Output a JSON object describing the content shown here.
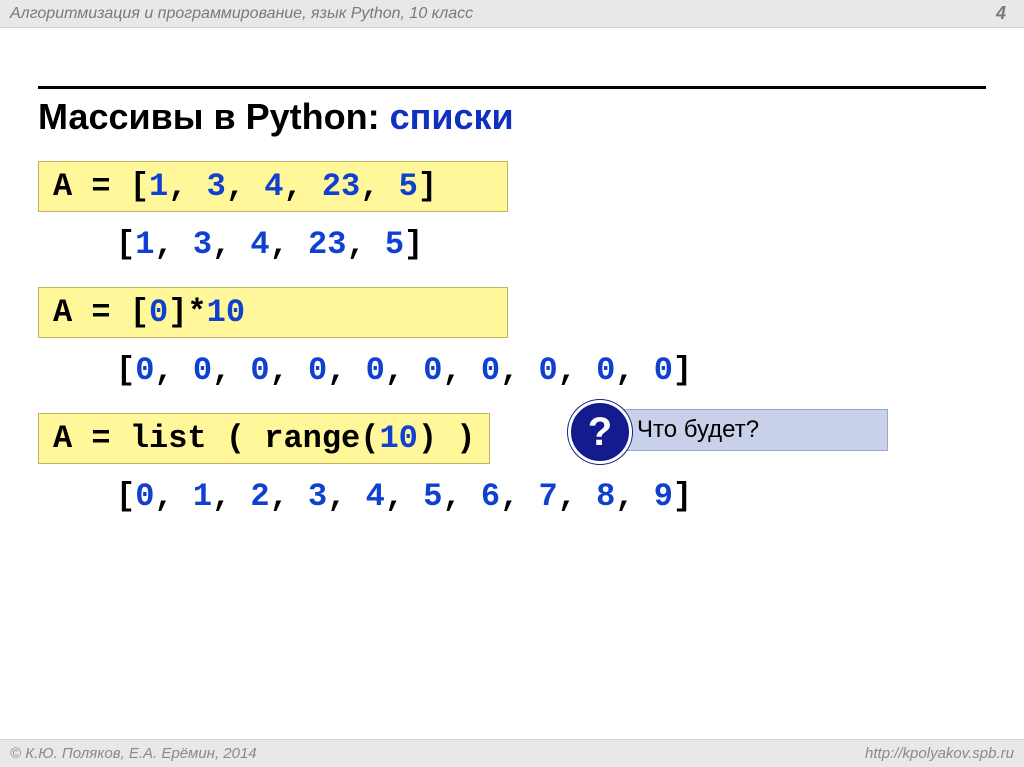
{
  "header": {
    "title": "Алгоритмизация и программирование, язык Python, 10 класс",
    "page": "4"
  },
  "heading": {
    "main": "Массивы в Python: ",
    "accent": "списки"
  },
  "code1": {
    "lhs": "A = [",
    "n1": "1",
    "c1": ", ",
    "n2": "3",
    "c2": ", ",
    "n3": "4",
    "c3": ", ",
    "n4": "23",
    "c4": ", ",
    "n5": "5",
    "rhs": "]"
  },
  "out1": {
    "l": "[",
    "n1": "1",
    "c1": ", ",
    "n2": "3",
    "c2": ", ",
    "n3": "4",
    "c3": ", ",
    "n4": "23",
    "c4": ", ",
    "n5": "5",
    "r": "]"
  },
  "code2": {
    "text1": "A = [",
    "zero": "0",
    "text2": "]*",
    "ten": "10"
  },
  "callout": {
    "icon": "?",
    "text": "Что будет?"
  },
  "out2": {
    "l": "[",
    "n1": "0",
    "c1": ", ",
    "n2": "0",
    "c2": ", ",
    "n3": "0",
    "c3": ", ",
    "n4": "0",
    "c4": ", ",
    "n5": "0",
    "c5": ", ",
    "n6": "0",
    "c6": ", ",
    "n7": "0",
    "c7": ", ",
    "n8": "0",
    "c8": ", ",
    "n9": "0",
    "c9": ", ",
    "n10": "0",
    "r": "]"
  },
  "code3": {
    "text1": "A = list ( range(",
    "ten": "10",
    "text2": ") )"
  },
  "out3": {
    "l": "[",
    "n1": "0",
    "c1": ", ",
    "n2": "1",
    "c2": ", ",
    "n3": "2",
    "c3": ", ",
    "n4": "3",
    "c4": ", ",
    "n5": "4",
    "c5": ", ",
    "n6": "5",
    "c6": ", ",
    "n7": "6",
    "c7": ", ",
    "n8": "7",
    "c8": ", ",
    "n9": "8",
    "c9": ", ",
    "n10": "9",
    "r": "]"
  },
  "footer": {
    "left": "К.Ю. Поляков, Е.А. Ерёмин, 2014",
    "right": "http://kpolyakov.spb.ru"
  }
}
